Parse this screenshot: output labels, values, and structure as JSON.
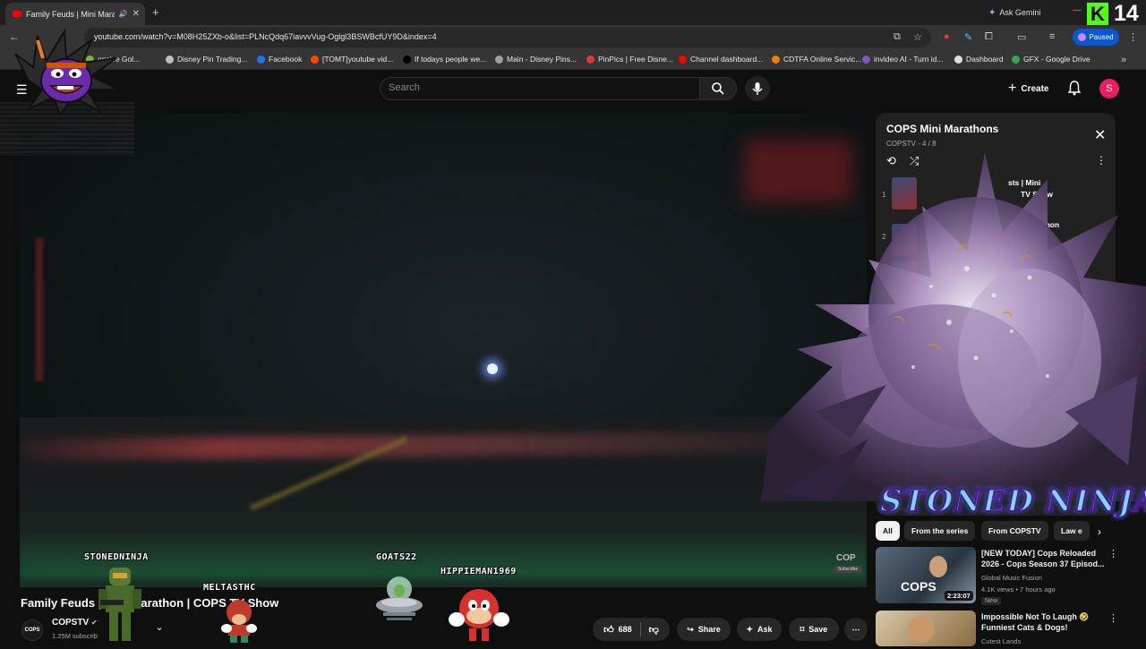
{
  "browser": {
    "tab_title": "Family Feuds | Mini Marath",
    "new_tab": "+",
    "ask_gemini": "Ask Gemini",
    "kick_letter": "K",
    "kick_count": "14",
    "url": "youtube.com/watch?v=M08H25ZXb-o&list=PLNcQdq67iavvvVug-Oglgl3BSWBcfUY9D&index=4",
    "paused": "Paused",
    "bookmarks": [
      {
        "label": "ensive Gol...",
        "color": "#7cb342"
      },
      {
        "label": "Disney Pin Trading...",
        "color": "#bdbdbd"
      },
      {
        "label": "Facebook",
        "color": "#1877f2"
      },
      {
        "label": "[TOMT]youtube vid...",
        "color": "#ff4500"
      },
      {
        "label": "If todays people we...",
        "color": "#000000"
      },
      {
        "label": "Main - Disney Pins...",
        "color": "#9e9e9e"
      },
      {
        "label": "PinPics | Free Disne...",
        "color": "#e53935"
      },
      {
        "label": "Channel dashboard...",
        "color": "#ff0000"
      },
      {
        "label": "CDTFA Online Servic...",
        "color": "#f57c00"
      },
      {
        "label": "invideo AI - Turn id...",
        "color": "#7e57c2"
      },
      {
        "label": "Dashboard",
        "color": "#e0e0e0"
      },
      {
        "label": "GFX - Google Drive",
        "color": "#34a853"
      }
    ]
  },
  "youtube": {
    "search_placeholder": "Search",
    "create_label": "Create",
    "avatar_letter": "S"
  },
  "video": {
    "title": "Family Feuds | Mini Marathon | COPS TV Show",
    "channel": "COPSTV",
    "channel_avatar": "COPS",
    "subscribers": "1.25M subscrib",
    "likes": "688",
    "share": "Share",
    "ask": "Ask",
    "save": "Save",
    "watermark": "COP",
    "watermark_sub": "Subscribe"
  },
  "playlist": {
    "title": "COPS Mini Marathons",
    "subtitle": "COPSTV - 4 / 8",
    "items": [
      {
        "num": "1",
        "line1": "sts | Mini",
        "line2": "TV Show"
      },
      {
        "num": "2",
        "line1": "arathon",
        "line2": ""
      }
    ]
  },
  "overlay": {
    "stoned_ninja": "STONED NINJA",
    "sprites": [
      {
        "name": "STONEDNINJA"
      },
      {
        "name": "MELTASTHC"
      },
      {
        "name": "GOATS22"
      },
      {
        "name": "HIPPIEMAN1969"
      }
    ]
  },
  "chips": [
    "All",
    "From the series",
    "From COPSTV",
    "Law e"
  ],
  "recommendations": [
    {
      "title": "[NEW TODAY] Cops Reloaded 2026 - Cops Season 37 Episod...",
      "channel": "Global Music Fusion",
      "meta": "4.1K views • 7 hours ago",
      "duration": "2:23:07",
      "badge": "New"
    },
    {
      "title": "Impossible Not To Laugh 🤣 Funniest Cats & Dogs!",
      "channel": "Cutest Lands",
      "meta": "",
      "duration": "",
      "badge": ""
    }
  ]
}
